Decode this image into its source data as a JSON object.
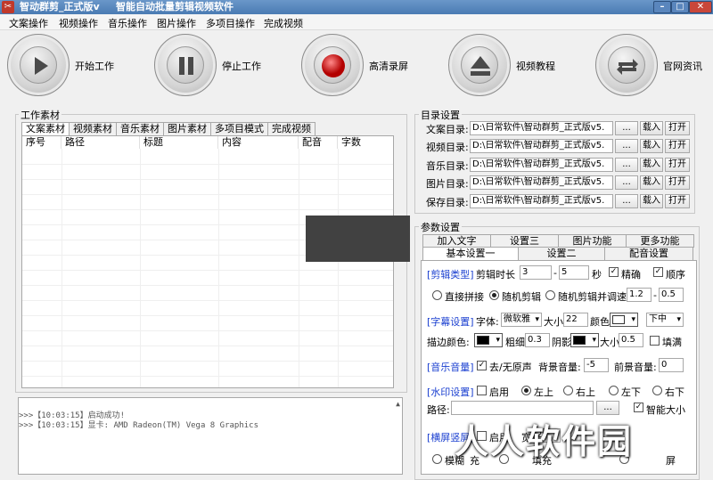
{
  "window": {
    "title": "智动群剪_正式版v",
    "subtitle": "智能自动批量剪辑视频软件",
    "min": "–",
    "max": "□",
    "close": "✕"
  },
  "menu": [
    "文案操作",
    "视频操作",
    "音乐操作",
    "图片操作",
    "多项目操作",
    "完成视频"
  ],
  "toolbar": [
    {
      "label": "开始工作",
      "icon": "play-icon"
    },
    {
      "label": "停止工作",
      "icon": "pause-icon"
    },
    {
      "label": "高清录屏",
      "icon": "record-icon"
    },
    {
      "label": "视频教程",
      "icon": "eject-icon"
    },
    {
      "label": "官网资讯",
      "icon": "refresh-icon"
    }
  ],
  "materials": {
    "title": "工作素材",
    "tabs": [
      "文案素材",
      "视频素材",
      "音乐素材",
      "图片素材",
      "多项目模式",
      "完成视频"
    ],
    "columns": [
      "序号",
      "路径",
      "标题",
      "内容",
      "配音",
      "字数"
    ]
  },
  "log": [
    ">>>【10:03:15】启动成功!",
    ">>>【10:03:15】显卡: AMD Radeon(TM) Vega 8 Graphics"
  ],
  "dirs": {
    "title": "目录设置",
    "rows": [
      {
        "label": "文案目录:",
        "value": "D:\\日常软件\\智动群剪_正式版v5."
      },
      {
        "label": "视频目录:",
        "value": "D:\\日常软件\\智动群剪_正式版v5."
      },
      {
        "label": "音乐目录:",
        "value": "D:\\日常软件\\智动群剪_正式版v5."
      },
      {
        "label": "图片目录:",
        "value": "D:\\日常软件\\智动群剪_正式版v5."
      },
      {
        "label": "保存目录:",
        "value": "D:\\日常软件\\智动群剪_正式版v5."
      }
    ],
    "browse": "...",
    "load": "载入",
    "open": "打开"
  },
  "params": {
    "title": "参数设置",
    "tabs_row1": [
      "加入文字",
      "设置三",
      "图片功能",
      "更多功能"
    ],
    "tabs_row2": [
      "基本设置一",
      "设置二",
      "配音设置"
    ],
    "clip": {
      "section": "[剪辑类型]",
      "duration_label": "剪辑时长",
      "min": "3",
      "dash": "-",
      "max": "5",
      "unit": "秒",
      "precise": "精确",
      "order": "顺序",
      "opt1": "直接拼接",
      "opt2": "随机剪辑",
      "opt3": "随机剪辑并调速",
      "speed_min": "1.2",
      "speed_max": "0.5"
    },
    "subtitle": {
      "section": "[字幕设置]",
      "font_label": "字体:",
      "font": "微软雅",
      "size_label": "大小",
      "size": "22",
      "color_label": "颜色",
      "position": "下中",
      "stroke_label": "描边颜色:",
      "thickness_label": "粗细",
      "thickness": "0.3",
      "shadow_label": "阴影",
      "shadow_size_label": "大小",
      "shadow_size": "0.5",
      "fill": "填满"
    },
    "music": {
      "section": "[音乐音量]",
      "remove": "去/无原声",
      "bg_label": "背景音量:",
      "bg": "-5",
      "fg_label": "前景音量:",
      "fg": "0"
    },
    "watermark": {
      "section": "[水印设置]",
      "enable": "启用",
      "pos1": "左上",
      "pos2": "右上",
      "pos3": "左下",
      "pos4": "右下",
      "path_label": "路径:",
      "browse": "...",
      "smart": "智能大小"
    },
    "screen": {
      "section": "[横屏竖屏]",
      "enable": "启用",
      "width_label": "宽",
      "width": "20",
      "opt1": "模糊",
      "opt2": "充",
      "opt3": "填充",
      "opt4": "屏"
    }
  },
  "overlay": {
    "watermark": "人人软件园"
  }
}
